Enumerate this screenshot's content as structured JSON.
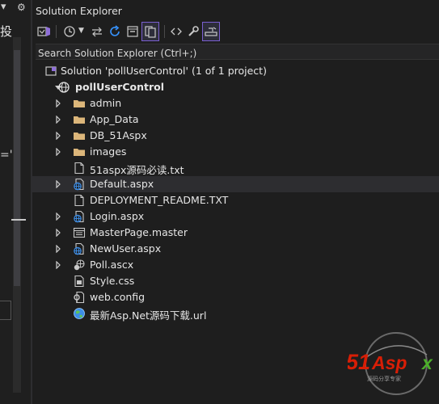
{
  "left_strip": {
    "toolbar_glyph": "▾",
    "gear_glyph": "⚙",
    "cjk_text": "投",
    "eq_mark": "='"
  },
  "panel": {
    "title": "Solution Explorer",
    "search": {
      "placeholder": "Search Solution Explorer (Ctrl+;)"
    },
    "toolbar": [
      {
        "name": "vs-switch-views-icon",
        "active": false
      },
      {
        "name": "history-icon",
        "active": false
      },
      {
        "name": "sync-arrows-icon",
        "active": false
      },
      {
        "name": "refresh-icon",
        "active": false
      },
      {
        "name": "collapse-all-icon",
        "active": false
      },
      {
        "name": "show-all-files-icon",
        "active": true
      },
      {
        "name": "code-view-icon",
        "active": false
      },
      {
        "name": "properties-wrench-icon",
        "active": false
      },
      {
        "name": "preview-selected-icon",
        "active": true
      }
    ],
    "tree": [
      {
        "label": "Solution 'pollUserControl' (1 of 1 project)",
        "icon": "solution-icon",
        "level": 0,
        "expander": "none",
        "bold": false
      },
      {
        "label": "pollUserControl",
        "icon": "website-globe-icon",
        "level": 0,
        "expander": "expanded",
        "bold": true
      },
      {
        "label": "admin",
        "icon": "folder-icon",
        "level": 1,
        "expander": "collapsed",
        "bold": false
      },
      {
        "label": "App_Data",
        "icon": "folder-icon",
        "level": 1,
        "expander": "collapsed",
        "bold": false
      },
      {
        "label": "DB_51Aspx",
        "icon": "folder-icon",
        "level": 1,
        "expander": "collapsed",
        "bold": false
      },
      {
        "label": "images",
        "icon": "folder-icon",
        "level": 1,
        "expander": "collapsed",
        "bold": false
      },
      {
        "label": "51aspx源码必读.txt",
        "icon": "text-file-icon",
        "level": 1,
        "expander": "none",
        "bold": false
      },
      {
        "label": "Default.aspx",
        "icon": "aspx-page-icon",
        "level": 1,
        "expander": "collapsed",
        "bold": false,
        "selected": true
      },
      {
        "label": "DEPLOYMENT_README.TXT",
        "icon": "text-file-icon",
        "level": 1,
        "expander": "none",
        "bold": false
      },
      {
        "label": "Login.aspx",
        "icon": "aspx-page-icon",
        "level": 1,
        "expander": "collapsed",
        "bold": false
      },
      {
        "label": "MasterPage.master",
        "icon": "master-page-icon",
        "level": 1,
        "expander": "collapsed",
        "bold": false
      },
      {
        "label": "NewUser.aspx",
        "icon": "aspx-page-icon",
        "level": 1,
        "expander": "collapsed",
        "bold": false
      },
      {
        "label": "Poll.ascx",
        "icon": "user-control-icon",
        "level": 1,
        "expander": "collapsed",
        "bold": false
      },
      {
        "label": "Style.css",
        "icon": "css-file-icon",
        "level": 1,
        "expander": "none",
        "bold": false
      },
      {
        "label": "web.config",
        "icon": "config-file-icon",
        "level": 1,
        "expander": "none",
        "bold": false
      },
      {
        "label": "最新Asp.Net源码下载.url",
        "icon": "internet-shortcut-icon",
        "level": 1,
        "expander": "none",
        "bold": false
      }
    ]
  },
  "watermark": {
    "brand": "51Aspx",
    "tagline": "源码分享专家"
  },
  "colors": {
    "background": "#1e1e1e",
    "folder": "#dcb67a",
    "accent": "#7a5fd1",
    "selected_row": "#2d2d30",
    "watermark_red": "#d81e06",
    "watermark_green": "#4caf2a"
  }
}
